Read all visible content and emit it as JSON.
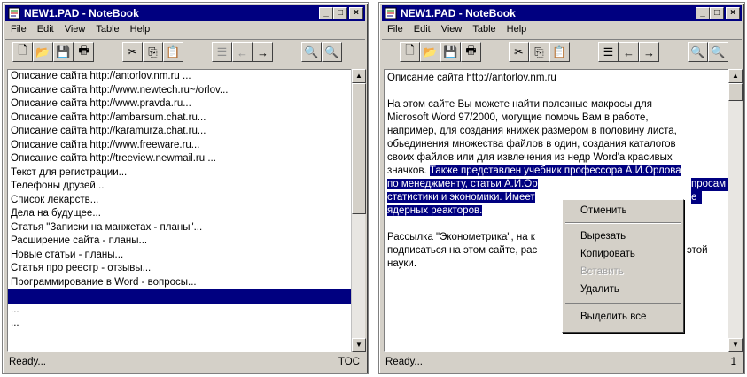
{
  "colors": {
    "titlebar": "#000080",
    "selection": "#000080",
    "chrome": "#d4d0c8"
  },
  "left": {
    "title": "NEW1.PAD - NoteBook",
    "menu": [
      "File",
      "Edit",
      "View",
      "Table",
      "Help"
    ],
    "items": [
      "Описание сайта http://antorlov.nm.ru ...",
      "Описание сайта http://www.newtech.ru~/orlov...",
      "Описание сайта http://www.pravda.ru...",
      "Описание сайта http://ambarsum.chat.ru...",
      "Описание сайта http://karamurza.chat.ru...",
      "Описание сайта http://www.freeware.ru...",
      "Описание сайта http://treeview.newmail.ru ...",
      "Текст для регистрации...",
      "Телефоны друзей...",
      "Список лекарств...",
      "Дела на будущее...",
      "Статья \"Записки на манжетах - планы\"...",
      "Расширение сайта - планы...",
      "Новые статьи - планы...",
      "Статья про реестр - отзывы...",
      "Программирование в Word - вопросы...",
      "",
      "...",
      "..."
    ],
    "selected_index": 16,
    "status_left": "Ready...",
    "status_right": "TOC"
  },
  "right": {
    "title": "NEW1.PAD - NoteBook",
    "menu": [
      "File",
      "Edit",
      "View",
      "Table",
      "Help"
    ],
    "lines": [
      {
        "text": "Описание сайта http://antorlov.nm.ru",
        "hl": ""
      },
      {
        "text": "",
        "hl": ""
      },
      {
        "text": "На этом сайте Вы можете найти полезные макросы для",
        "hl": ""
      },
      {
        "text": "Microsoft Word 97/2000, могущие помочь Вам в работе,",
        "hl": ""
      },
      {
        "text": "например, для создания книжек размером в половину листа,",
        "hl": ""
      },
      {
        "text": "обьединения множества файлов в один, создания каталогов",
        "hl": ""
      },
      {
        "text": "своих файлов или для извлечения из недр Word'a красивых",
        "hl": ""
      },
      {
        "text": "значков. ",
        "hl": "Также представлен учебник профессора А.И.Орлова"
      },
      {
        "text": "",
        "hl": "по менеджменту, статьи А.И.Ор"
      },
      {
        "text": "",
        "hl": "статистики и экономики. Имеет"
      },
      {
        "text": "",
        "hl": "ядерных реакторов."
      },
      {
        "text": "",
        "hl": ""
      },
      {
        "text": "Рассылка \"Эконометрика\", на к",
        "hl": ""
      },
      {
        "text": "подписаться на этом сайте, рас",
        "hl": ""
      },
      {
        "text": "науки.",
        "hl": ""
      }
    ],
    "tails": {
      "l8": "просам",
      "l9": "е",
      "l13": "этой"
    },
    "status_left": "Ready...",
    "status_right": "1"
  },
  "context_menu": {
    "undo": "Отменить",
    "cut": "Вырезать",
    "copy": "Копировать",
    "paste": "Вставить",
    "delete": "Удалить",
    "select_all": "Выделить все"
  }
}
